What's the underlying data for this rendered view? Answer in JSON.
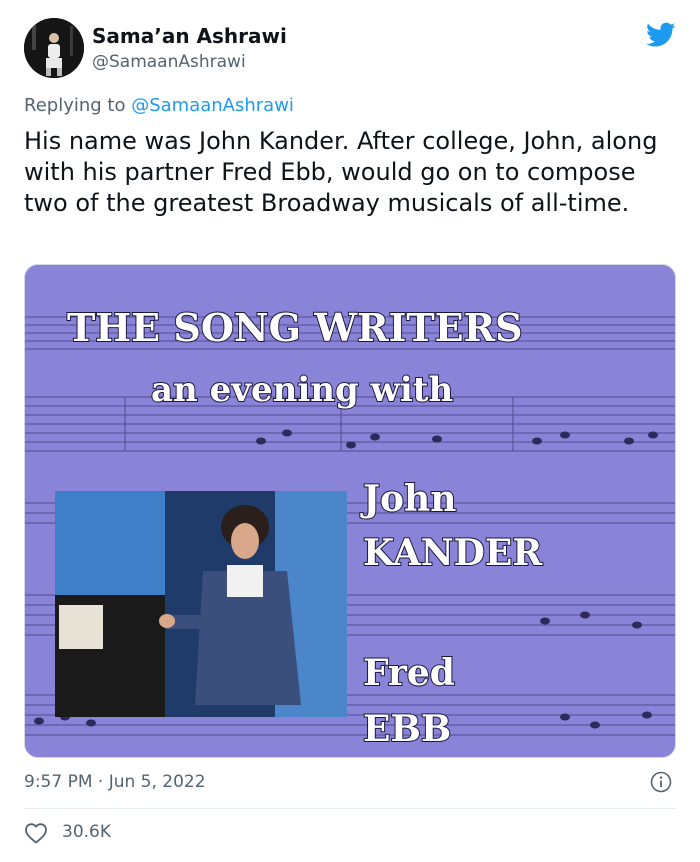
{
  "author": {
    "name": "Sama’an Ashrawi",
    "handle": "@SamaanAshrawi"
  },
  "reply": {
    "prefix": "Replying to ",
    "handle": "@SamaanAshrawi"
  },
  "tweet": {
    "text": "His name was John Kander. After college, John, along with his partner Fred Ebb, would go on to compose two of the greatest Broadway musicals of all-time."
  },
  "media": {
    "line1": "THE SONG WRITERS",
    "line2": "an evening with",
    "name1_first": "John",
    "name1_last": "KANDER",
    "name2_first": "Fred",
    "name2_last": "EBB"
  },
  "meta": {
    "timestamp": "9:57 PM · Jun 5, 2022",
    "likes": "30.6K"
  },
  "icons": {
    "brand": "twitter-bird-icon",
    "info": "info-icon",
    "like": "heart-icon"
  },
  "colors": {
    "brand": "#1d9bf0",
    "secondary_text": "#536471",
    "media_bg": "#8a84d9"
  }
}
